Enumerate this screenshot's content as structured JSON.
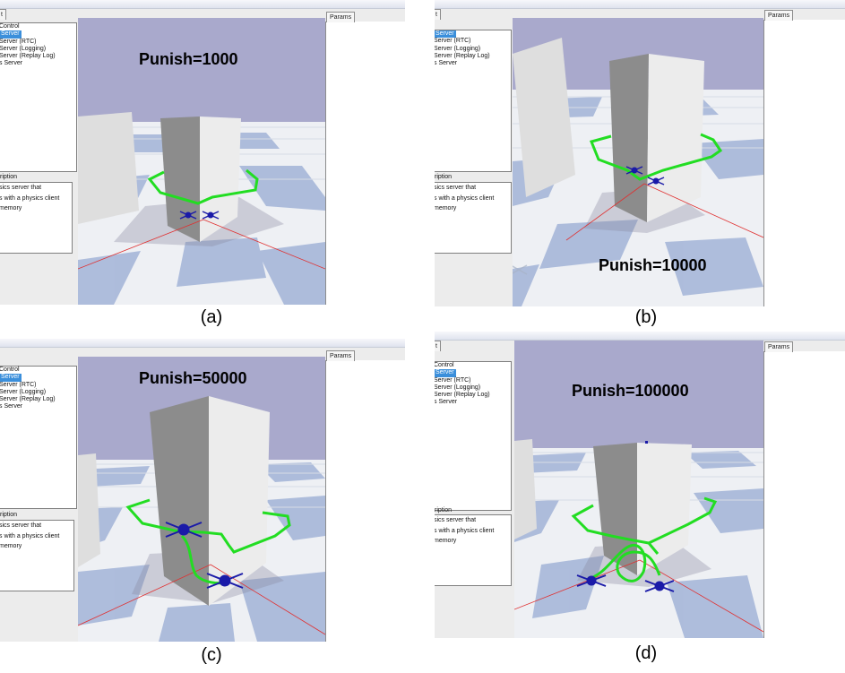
{
  "panels": [
    {
      "id": "a",
      "caption": "(a)",
      "punish": "Punish=1000",
      "tab_fragment": "t",
      "tree_items": [
        "Control",
        "Server",
        "Server (RTC)",
        "Server (Logging)",
        "Server (Replay Log)",
        "s Server"
      ],
      "description_label": "ription",
      "description_lines": [
        "sics server that",
        "s with a physics client",
        "memory"
      ],
      "params_tab": "Params"
    },
    {
      "id": "b",
      "caption": "(b)",
      "punish": "Punish=10000",
      "tab_fragment": "t",
      "tree_items": [
        "",
        "Server",
        "Server (RTC)",
        "Server (Logging)",
        "Server (Replay Log)",
        "s Server"
      ],
      "description_label": "ription",
      "description_lines": [
        "sics server that",
        "s with a physics client",
        "memory"
      ],
      "params_tab": "Params"
    },
    {
      "id": "c",
      "caption": "(c)",
      "punish": "Punish=50000",
      "tab_fragment": "",
      "tree_items": [
        "Control",
        "Server",
        "Server (RTC)",
        "Server (Logging)",
        "Server (Replay Log)",
        "s Server"
      ],
      "description_label": "ription",
      "description_lines": [
        "sics server that",
        "s with a physics client",
        "memory"
      ],
      "params_tab": "Params"
    },
    {
      "id": "d",
      "caption": "(d)",
      "punish": "Punish=100000",
      "tab_fragment": "t",
      "tree_items": [
        "Control",
        "Server",
        "Server (RTC)",
        "Server (Logging)",
        "Server (Replay Log)",
        "s Server"
      ],
      "description_label": "ription",
      "description_lines": [
        "sics server that",
        "s with a physics client",
        "memory"
      ],
      "params_tab": "Params"
    }
  ],
  "colors": {
    "sky": "#a9a9cc",
    "floor_light": "#f2f2f2",
    "floor_blue": "#9db0d6",
    "trajectory": "#22dd22",
    "drone": "#1a1aa8",
    "axis": "#e03030",
    "selection": "#3b8fdb"
  }
}
